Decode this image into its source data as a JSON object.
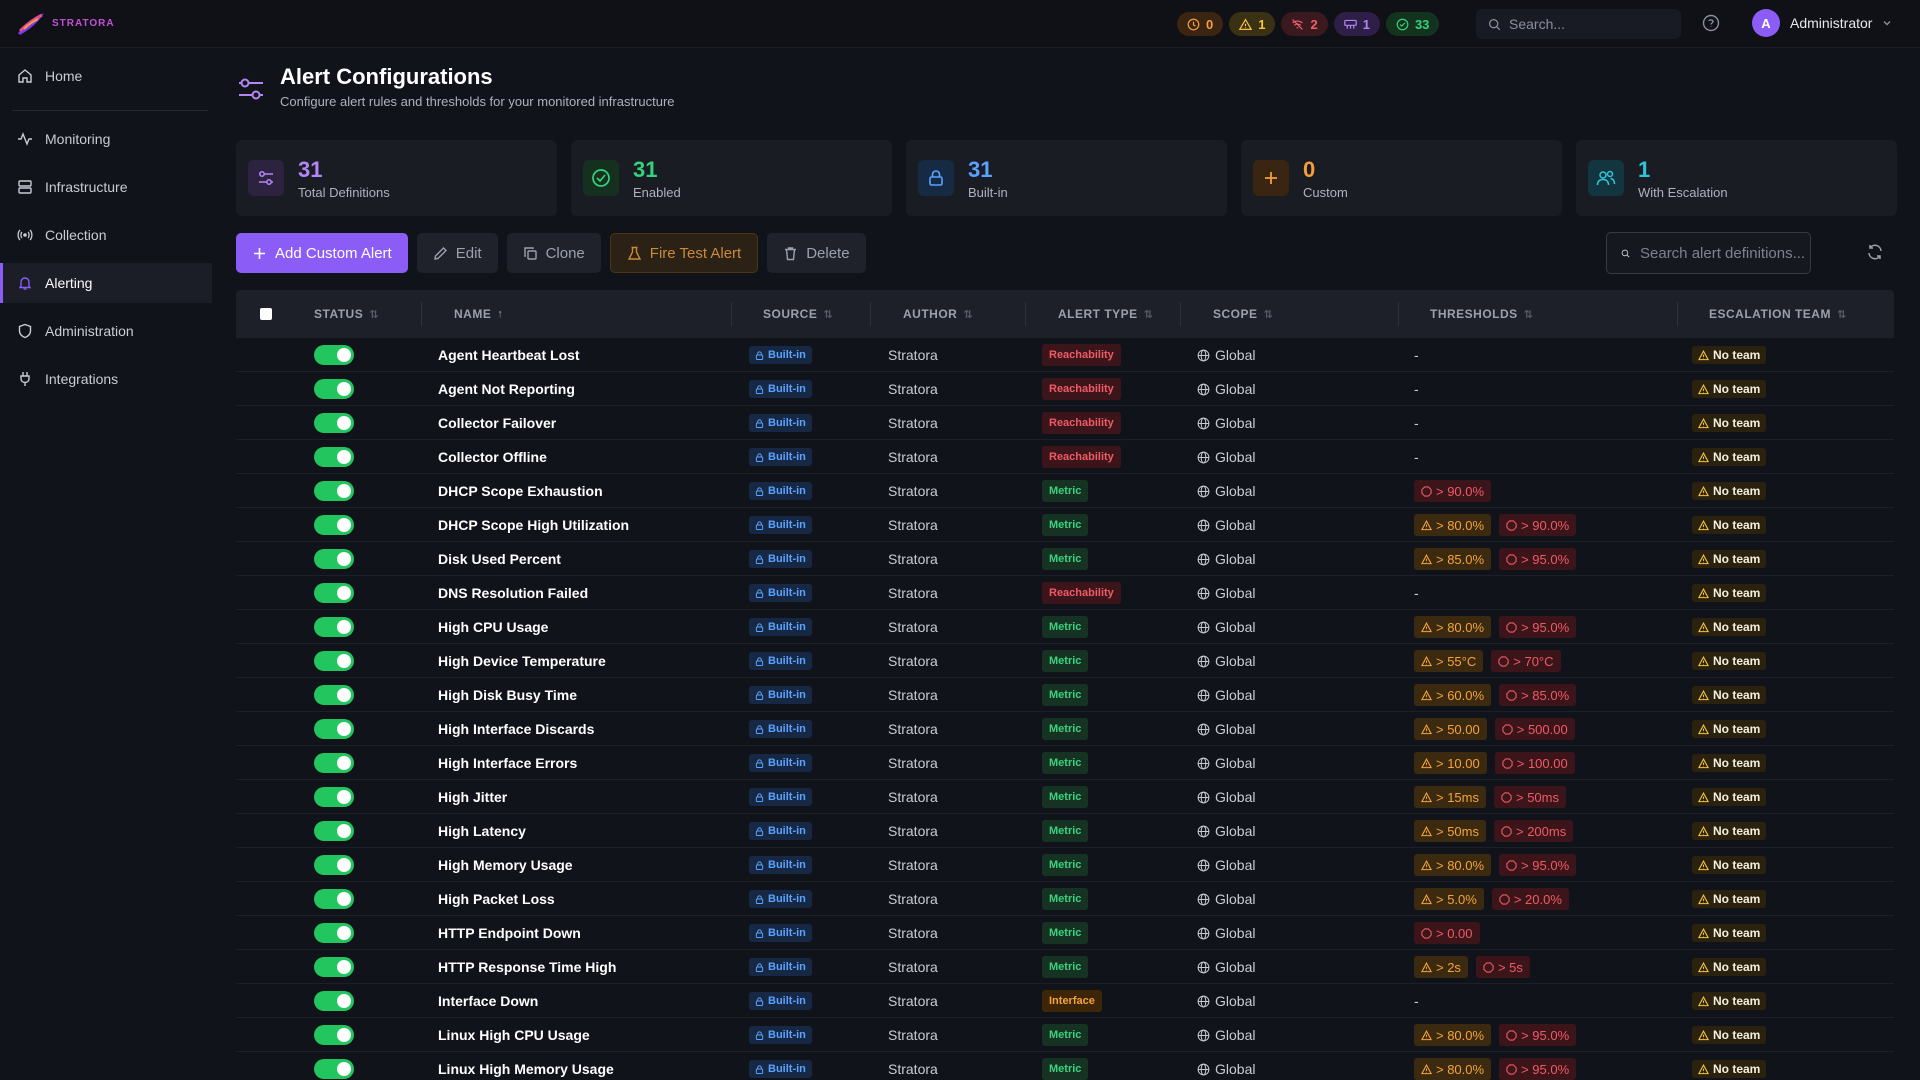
{
  "app": {
    "logo_text": "STRATORA"
  },
  "topbar": {
    "pills": [
      {
        "value": "0",
        "icon": "clock-icon",
        "color": "#f59e3b"
      },
      {
        "value": "1",
        "icon": "warning-icon",
        "color": "#f5c542"
      },
      {
        "value": "2",
        "icon": "no-signal-icon",
        "color": "#f0606a"
      },
      {
        "value": "1",
        "icon": "network-icon",
        "color": "#b486f5"
      },
      {
        "value": "33",
        "icon": "check-circle-icon",
        "color": "#34d27a"
      }
    ],
    "search_placeholder": "Search...",
    "user_initial": "A",
    "user_name": "Administrator"
  },
  "sidebar": {
    "items": [
      {
        "label": "Home",
        "icon": "home-icon"
      },
      {
        "label": "Monitoring",
        "icon": "activity-icon"
      },
      {
        "label": "Infrastructure",
        "icon": "server-icon"
      },
      {
        "label": "Collection",
        "icon": "radio-icon"
      },
      {
        "label": "Alerting",
        "icon": "bell-icon",
        "active": true
      },
      {
        "label": "Administration",
        "icon": "shield-icon"
      },
      {
        "label": "Integrations",
        "icon": "plug-icon"
      }
    ]
  },
  "header": {
    "title": "Alert Configurations",
    "subtitle": "Configure alert rules and thresholds for your monitored infrastructure"
  },
  "stats": [
    {
      "value": "31",
      "label": "Total Definitions",
      "color": "#b486f5"
    },
    {
      "value": "31",
      "label": "Enabled",
      "color": "#34d27a"
    },
    {
      "value": "31",
      "label": "Built-in",
      "color": "#5aa2ff"
    },
    {
      "value": "0",
      "label": "Custom",
      "color": "#f59e3b"
    },
    {
      "value": "1",
      "label": "With Escalation",
      "color": "#2ec5d8"
    }
  ],
  "toolbar": {
    "add_label": "Add Custom Alert",
    "edit_label": "Edit",
    "clone_label": "Clone",
    "fire_label": "Fire Test Alert",
    "delete_label": "Delete",
    "search_placeholder": "Search alert definitions..."
  },
  "table": {
    "columns": [
      "STATUS",
      "NAME",
      "SOURCE",
      "AUTHOR",
      "ALERT TYPE",
      "SCOPE",
      "THRESHOLDS",
      "ESCALATION TEAM"
    ],
    "rows": [
      {
        "name": "Agent Heartbeat Lost",
        "source": "Built-in",
        "author": "Stratora",
        "type": "Reachability",
        "scope": "Global",
        "warn": "",
        "crit": "",
        "team": "No team"
      },
      {
        "name": "Agent Not Reporting",
        "source": "Built-in",
        "author": "Stratora",
        "type": "Reachability",
        "scope": "Global",
        "warn": "",
        "crit": "",
        "team": "No team"
      },
      {
        "name": "Collector Failover",
        "source": "Built-in",
        "author": "Stratora",
        "type": "Reachability",
        "scope": "Global",
        "warn": "",
        "crit": "",
        "team": "No team"
      },
      {
        "name": "Collector Offline",
        "source": "Built-in",
        "author": "Stratora",
        "type": "Reachability",
        "scope": "Global",
        "warn": "",
        "crit": "",
        "team": "No team"
      },
      {
        "name": "DHCP Scope Exhaustion",
        "source": "Built-in",
        "author": "Stratora",
        "type": "Metric",
        "scope": "Global",
        "warn": "",
        "crit": "> 90.0%",
        "team": "No team"
      },
      {
        "name": "DHCP Scope High Utilization",
        "source": "Built-in",
        "author": "Stratora",
        "type": "Metric",
        "scope": "Global",
        "warn": "> 80.0%",
        "crit": "> 90.0%",
        "team": "No team"
      },
      {
        "name": "Disk Used Percent",
        "source": "Built-in",
        "author": "Stratora",
        "type": "Metric",
        "scope": "Global",
        "warn": "> 85.0%",
        "crit": "> 95.0%",
        "team": "No team"
      },
      {
        "name": "DNS Resolution Failed",
        "source": "Built-in",
        "author": "Stratora",
        "type": "Reachability",
        "scope": "Global",
        "warn": "",
        "crit": "",
        "team": "No team"
      },
      {
        "name": "High CPU Usage",
        "source": "Built-in",
        "author": "Stratora",
        "type": "Metric",
        "scope": "Global",
        "warn": "> 80.0%",
        "crit": "> 95.0%",
        "team": "No team"
      },
      {
        "name": "High Device Temperature",
        "source": "Built-in",
        "author": "Stratora",
        "type": "Metric",
        "scope": "Global",
        "warn": "> 55°C",
        "crit": "> 70°C",
        "team": "No team"
      },
      {
        "name": "High Disk Busy Time",
        "source": "Built-in",
        "author": "Stratora",
        "type": "Metric",
        "scope": "Global",
        "warn": "> 60.0%",
        "crit": "> 85.0%",
        "team": "No team"
      },
      {
        "name": "High Interface Discards",
        "source": "Built-in",
        "author": "Stratora",
        "type": "Metric",
        "scope": "Global",
        "warn": "> 50.00",
        "crit": "> 500.00",
        "team": "No team"
      },
      {
        "name": "High Interface Errors",
        "source": "Built-in",
        "author": "Stratora",
        "type": "Metric",
        "scope": "Global",
        "warn": "> 10.00",
        "crit": "> 100.00",
        "team": "No team"
      },
      {
        "name": "High Jitter",
        "source": "Built-in",
        "author": "Stratora",
        "type": "Metric",
        "scope": "Global",
        "warn": "> 15ms",
        "crit": "> 50ms",
        "team": "No team"
      },
      {
        "name": "High Latency",
        "source": "Built-in",
        "author": "Stratora",
        "type": "Metric",
        "scope": "Global",
        "warn": "> 50ms",
        "crit": "> 200ms",
        "team": "No team"
      },
      {
        "name": "High Memory Usage",
        "source": "Built-in",
        "author": "Stratora",
        "type": "Metric",
        "scope": "Global",
        "warn": "> 80.0%",
        "crit": "> 95.0%",
        "team": "No team"
      },
      {
        "name": "High Packet Loss",
        "source": "Built-in",
        "author": "Stratora",
        "type": "Metric",
        "scope": "Global",
        "warn": "> 5.0%",
        "crit": "> 20.0%",
        "team": "No team"
      },
      {
        "name": "HTTP Endpoint Down",
        "source": "Built-in",
        "author": "Stratora",
        "type": "Metric",
        "scope": "Global",
        "warn": "",
        "crit": "> 0.00",
        "team": "No team"
      },
      {
        "name": "HTTP Response Time High",
        "source": "Built-in",
        "author": "Stratora",
        "type": "Metric",
        "scope": "Global",
        "warn": "> 2s",
        "crit": "> 5s",
        "team": "No team"
      },
      {
        "name": "Interface Down",
        "source": "Built-in",
        "author": "Stratora",
        "type": "Interface",
        "scope": "Global",
        "warn": "",
        "crit": "",
        "team": "No team"
      },
      {
        "name": "Linux High CPU Usage",
        "source": "Built-in",
        "author": "Stratora",
        "type": "Metric",
        "scope": "Global",
        "warn": "> 80.0%",
        "crit": "> 95.0%",
        "team": "No team"
      },
      {
        "name": "Linux High Memory Usage",
        "source": "Built-in",
        "author": "Stratora",
        "type": "Metric",
        "scope": "Global",
        "warn": "> 80.0%",
        "crit": "> 95.0%",
        "team": "No team"
      }
    ]
  }
}
